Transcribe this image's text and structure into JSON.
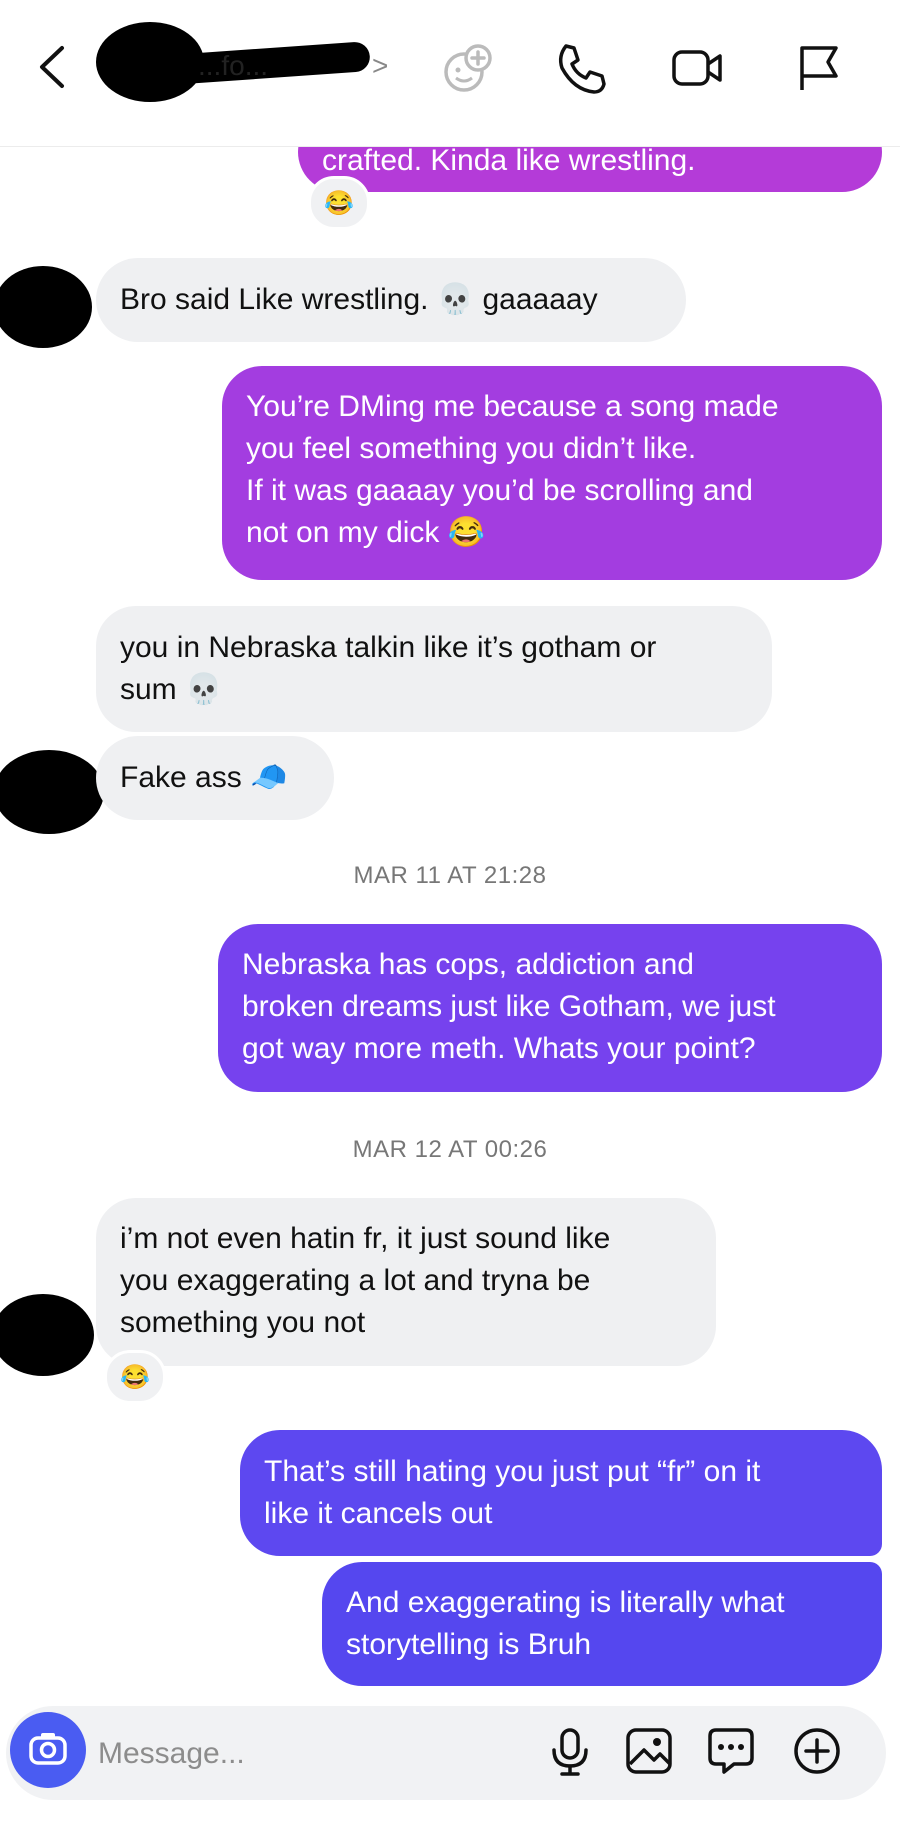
{
  "header": {
    "contact_name": "...fo...",
    "chevron": ">",
    "icons": [
      "back-icon",
      "games-icon",
      "phone-icon",
      "video-icon",
      "flag-icon"
    ]
  },
  "messages": [
    {
      "id": "m0",
      "side": "sent",
      "text": "crafted. Kinda like wrestling.",
      "reaction": "😂"
    },
    {
      "id": "m1",
      "side": "received",
      "text": "Bro said Like wrestling. 💀 gaaaaay"
    },
    {
      "id": "m2",
      "side": "sent",
      "lines": [
        "You’re DMing me because a song made",
        "you feel something you didn’t like.",
        "If it was gaaaay you’d be scrolling and",
        "not on my dick 😂"
      ]
    },
    {
      "id": "m3",
      "side": "received",
      "lines": [
        "you in Nebraska talkin like it’s gotham  or",
        "sum 💀"
      ]
    },
    {
      "id": "m4",
      "side": "received",
      "text": "Fake ass 🧢"
    },
    {
      "id": "m5",
      "side": "sent",
      "lines": [
        "Nebraska has cops, addiction and",
        "broken dreams just like Gotham, we just",
        "got way more meth. Whats your point?"
      ]
    },
    {
      "id": "m6",
      "side": "received",
      "lines": [
        "i’m not even hatin fr, it just sound like",
        "you exaggerating a lot and tryna be",
        "something you not"
      ],
      "reaction": "😂"
    },
    {
      "id": "m7",
      "side": "sent",
      "lines": [
        "That’s still hating you just put “fr” on it",
        "like it cancels out"
      ]
    },
    {
      "id": "m8",
      "side": "sent",
      "lines": [
        "And exaggerating is literally what",
        "storytelling is Bruh"
      ]
    }
  ],
  "timestamps": {
    "t1": "MAR 11 AT 21:28",
    "t2": "MAR 12 AT 00:26"
  },
  "composer": {
    "placeholder": "Message...",
    "icons": [
      "camera-icon",
      "microphone-icon",
      "gallery-icon",
      "sticker-icon",
      "plus-icon"
    ]
  },
  "colors": {
    "sent_gradient": [
      "#b03ad8",
      "#9a3ee2",
      "#7440f2",
      "#5b48f0"
    ],
    "received_bg": "#eff0f2",
    "camera_bg": "#4a5cf2"
  }
}
